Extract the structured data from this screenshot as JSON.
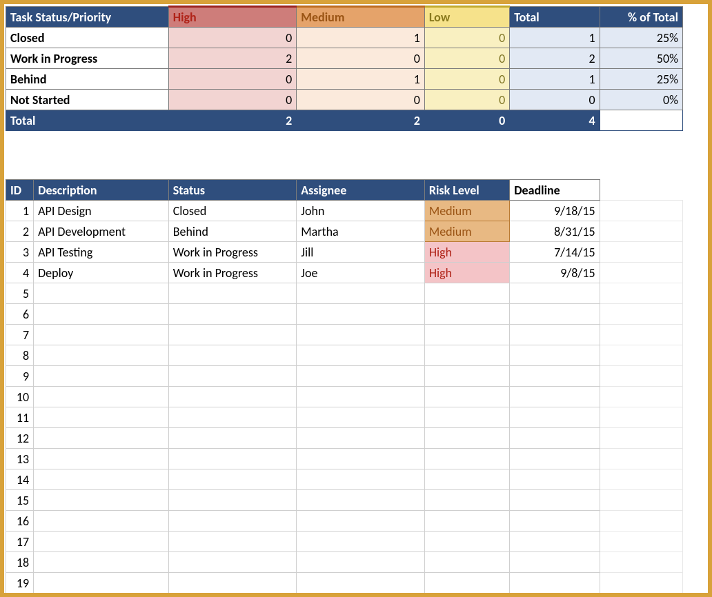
{
  "summary": {
    "cornerHeader": "Task Status/Priority",
    "cols": {
      "high": "High",
      "med": "Medium",
      "low": "Low",
      "total": "Total",
      "pct": "% of Total"
    },
    "rows": [
      {
        "label": "Closed",
        "high": 0,
        "med": 1,
        "low": 0,
        "total": 1,
        "pct": "25%"
      },
      {
        "label": "Work in Progress",
        "high": 2,
        "med": 0,
        "low": 0,
        "total": 2,
        "pct": "50%"
      },
      {
        "label": "Behind",
        "high": 0,
        "med": 1,
        "low": 0,
        "total": 1,
        "pct": "25%"
      },
      {
        "label": "Not Started",
        "high": 0,
        "med": 0,
        "low": 0,
        "total": 0,
        "pct": "0%"
      }
    ],
    "totals": {
      "label": "Total",
      "high": 2,
      "med": 2,
      "low": 0,
      "total": 4,
      "pct": ""
    }
  },
  "tasks": {
    "headers": {
      "id": "ID",
      "description": "Description",
      "status": "Status",
      "assignee": "Assignee",
      "risk": "Risk Level",
      "deadline": "Deadline"
    },
    "rows": [
      {
        "id": 1,
        "description": "API Design",
        "status": "Closed",
        "assignee": "John",
        "risk": "Medium",
        "deadline": "9/18/15"
      },
      {
        "id": 2,
        "description": "API Development",
        "status": "Behind",
        "assignee": "Martha",
        "risk": "Medium",
        "deadline": "8/31/15"
      },
      {
        "id": 3,
        "description": "API Testing",
        "status": "Work in Progress",
        "assignee": "Jill",
        "risk": "High",
        "deadline": "7/14/15"
      },
      {
        "id": 4,
        "description": "Deploy",
        "status": "Work in Progress",
        "assignee": "Joe",
        "risk": "High",
        "deadline": "9/8/15"
      },
      {
        "id": 5,
        "description": "",
        "status": "",
        "assignee": "",
        "risk": "",
        "deadline": ""
      },
      {
        "id": 6,
        "description": "",
        "status": "",
        "assignee": "",
        "risk": "",
        "deadline": ""
      },
      {
        "id": 7,
        "description": "",
        "status": "",
        "assignee": "",
        "risk": "",
        "deadline": ""
      },
      {
        "id": 8,
        "description": "",
        "status": "",
        "assignee": "",
        "risk": "",
        "deadline": ""
      },
      {
        "id": 9,
        "description": "",
        "status": "",
        "assignee": "",
        "risk": "",
        "deadline": ""
      },
      {
        "id": 10,
        "description": "",
        "status": "",
        "assignee": "",
        "risk": "",
        "deadline": ""
      },
      {
        "id": 11,
        "description": "",
        "status": "",
        "assignee": "",
        "risk": "",
        "deadline": ""
      },
      {
        "id": 12,
        "description": "",
        "status": "",
        "assignee": "",
        "risk": "",
        "deadline": ""
      },
      {
        "id": 13,
        "description": "",
        "status": "",
        "assignee": "",
        "risk": "",
        "deadline": ""
      },
      {
        "id": 14,
        "description": "",
        "status": "",
        "assignee": "",
        "risk": "",
        "deadline": ""
      },
      {
        "id": 15,
        "description": "",
        "status": "",
        "assignee": "",
        "risk": "",
        "deadline": ""
      },
      {
        "id": 16,
        "description": "",
        "status": "",
        "assignee": "",
        "risk": "",
        "deadline": ""
      },
      {
        "id": 17,
        "description": "",
        "status": "",
        "assignee": "",
        "risk": "",
        "deadline": ""
      },
      {
        "id": 18,
        "description": "",
        "status": "",
        "assignee": "",
        "risk": "",
        "deadline": ""
      },
      {
        "id": 19,
        "description": "",
        "status": "",
        "assignee": "",
        "risk": "",
        "deadline": ""
      }
    ]
  }
}
